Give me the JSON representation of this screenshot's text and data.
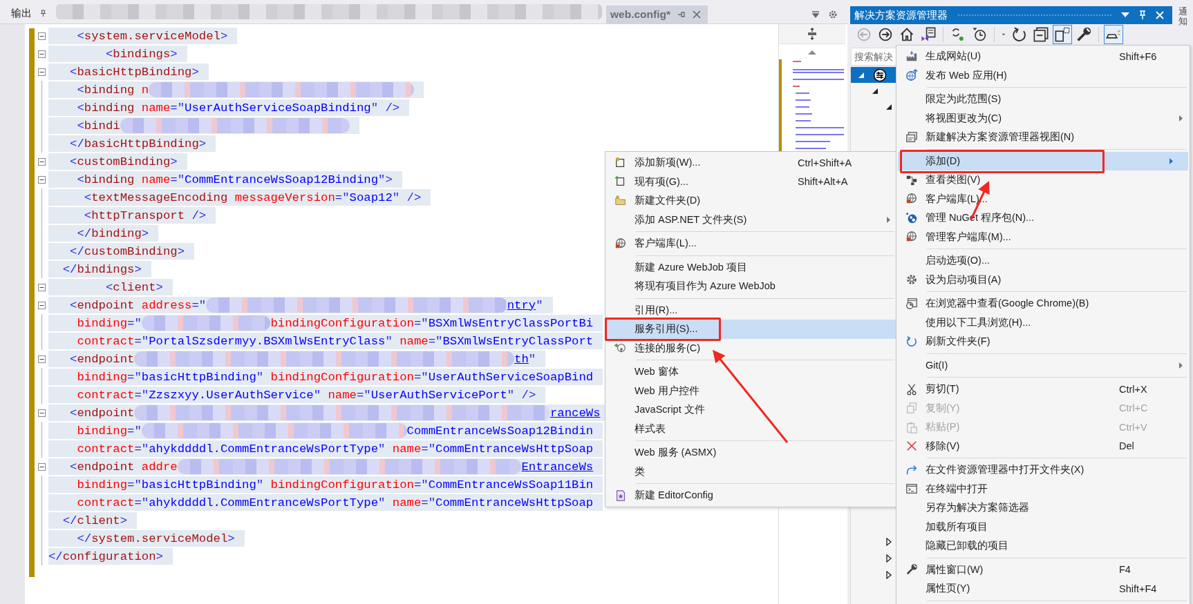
{
  "doc_tabs": [
    {
      "title": "输出",
      "selected": false,
      "kind": "tool"
    },
    {
      "kind": "redacted"
    },
    {
      "title": "web.config*",
      "selected": true,
      "kind": "document"
    }
  ],
  "editor": {
    "lines": [
      {
        "fold": true,
        "tokens": [
          {
            "kind": "punct",
            "text": "    <"
          },
          {
            "kind": "tag",
            "text": "system.serviceModel"
          },
          {
            "kind": "punct",
            "text": ">"
          }
        ]
      },
      {
        "fold": true,
        "tokens": [
          {
            "kind": "punct",
            "text": "        <"
          },
          {
            "kind": "tag",
            "text": "bindings"
          },
          {
            "kind": "punct",
            "text": ">"
          }
        ]
      },
      {
        "fold": true,
        "tokens": [
          {
            "kind": "punct",
            "text": "   <"
          },
          {
            "kind": "tag",
            "text": "basicHttpBinding"
          },
          {
            "kind": "punct",
            "text": ">"
          }
        ]
      },
      {
        "fold": false,
        "tokens": [
          {
            "kind": "punct",
            "text": "    <"
          },
          {
            "kind": "tag",
            "text": "binding"
          },
          {
            "kind": "attr",
            "text": " n"
          },
          {
            "kind": "redacted"
          }
        ]
      },
      {
        "fold": false,
        "tokens": [
          {
            "kind": "punct",
            "text": "    <"
          },
          {
            "kind": "tag",
            "text": "binding"
          },
          {
            "kind": "attr",
            "text": " name"
          },
          {
            "kind": "punct",
            "text": "=\""
          },
          {
            "kind": "value",
            "text": "UserAuthServiceSoapBinding"
          },
          {
            "kind": "punct",
            "text": "\" />"
          }
        ]
      },
      {
        "fold": false,
        "tokens": [
          {
            "kind": "punct",
            "text": "    <"
          },
          {
            "kind": "tag",
            "text": "bindi"
          },
          {
            "kind": "redacted"
          }
        ]
      },
      {
        "fold": false,
        "tokens": [
          {
            "kind": "punct",
            "text": "   </"
          },
          {
            "kind": "tag",
            "text": "basicHttpBinding"
          },
          {
            "kind": "punct",
            "text": ">"
          }
        ]
      },
      {
        "fold": true,
        "tokens": [
          {
            "kind": "punct",
            "text": "   <"
          },
          {
            "kind": "tag",
            "text": "customBinding"
          },
          {
            "kind": "punct",
            "text": ">"
          }
        ]
      },
      {
        "fold": true,
        "tokens": [
          {
            "kind": "punct",
            "text": "    <"
          },
          {
            "kind": "tag",
            "text": "binding"
          },
          {
            "kind": "attr",
            "text": " name"
          },
          {
            "kind": "punct",
            "text": "=\""
          },
          {
            "kind": "value",
            "text": "CommEntranceWsSoap12Binding"
          },
          {
            "kind": "punct",
            "text": "\">"
          }
        ]
      },
      {
        "fold": false,
        "tokens": [
          {
            "kind": "punct",
            "text": "     <"
          },
          {
            "kind": "tag",
            "text": "textMessageEncoding"
          },
          {
            "kind": "attr",
            "text": " messageVersion"
          },
          {
            "kind": "punct",
            "text": "=\""
          },
          {
            "kind": "value",
            "text": "Soap12"
          },
          {
            "kind": "punct",
            "text": "\" />"
          }
        ]
      },
      {
        "fold": false,
        "tokens": [
          {
            "kind": "punct",
            "text": "     <"
          },
          {
            "kind": "tag",
            "text": "httpTransport"
          },
          {
            "kind": "punct",
            "text": " />"
          }
        ]
      },
      {
        "fold": false,
        "tokens": [
          {
            "kind": "punct",
            "text": "    </"
          },
          {
            "kind": "tag",
            "text": "binding"
          },
          {
            "kind": "punct",
            "text": ">"
          }
        ]
      },
      {
        "fold": false,
        "tokens": [
          {
            "kind": "punct",
            "text": "   </"
          },
          {
            "kind": "tag",
            "text": "customBinding"
          },
          {
            "kind": "punct",
            "text": ">"
          }
        ]
      },
      {
        "fold": false,
        "tokens": [
          {
            "kind": "punct",
            "text": "  </"
          },
          {
            "kind": "tag",
            "text": "bindings"
          },
          {
            "kind": "punct",
            "text": ">"
          }
        ]
      },
      {
        "fold": true,
        "tokens": [
          {
            "kind": "punct",
            "text": "        <"
          },
          {
            "kind": "tag",
            "text": "client"
          },
          {
            "kind": "punct",
            "text": ">"
          }
        ]
      },
      {
        "fold": true,
        "tokens": [
          {
            "kind": "punct",
            "text": "   <"
          },
          {
            "kind": "tag",
            "text": "endpoint"
          },
          {
            "kind": "attr",
            "text": " address"
          },
          {
            "kind": "punct",
            "text": "=\""
          },
          {
            "kind": "redacted"
          },
          {
            "kind": "link",
            "text": "ntry"
          },
          {
            "kind": "punct",
            "text": "\""
          }
        ]
      },
      {
        "fold": false,
        "tokens": [
          {
            "kind": "attr",
            "text": "    binding"
          },
          {
            "kind": "punct",
            "text": "=\""
          },
          {
            "kind": "redacted"
          },
          {
            "kind": "attr",
            "text": "bindingConfiguration"
          },
          {
            "kind": "punct",
            "text": "=\""
          },
          {
            "kind": "value",
            "text": "BSXmlWsEntryClassPortBi"
          }
        ]
      },
      {
        "fold": false,
        "tokens": [
          {
            "kind": "attr",
            "text": "    contract"
          },
          {
            "kind": "punct",
            "text": "=\""
          },
          {
            "kind": "value",
            "text": "PortalSzsdermyy.BSXmlWsEntryClass"
          },
          {
            "kind": "punct",
            "text": "\""
          },
          {
            "kind": "attr",
            "text": " name"
          },
          {
            "kind": "punct",
            "text": "=\""
          },
          {
            "kind": "value",
            "text": "BSXmlWsEntryClassPort"
          }
        ]
      },
      {
        "fold": true,
        "tokens": [
          {
            "kind": "punct",
            "text": "   <"
          },
          {
            "kind": "tag",
            "text": "endpoint"
          },
          {
            "kind": "redacted"
          },
          {
            "kind": "link",
            "text": "th"
          },
          {
            "kind": "punct",
            "text": "\""
          }
        ]
      },
      {
        "fold": false,
        "tokens": [
          {
            "kind": "attr",
            "text": "    binding"
          },
          {
            "kind": "punct",
            "text": "=\""
          },
          {
            "kind": "value",
            "text": "basicHttpBinding"
          },
          {
            "kind": "punct",
            "text": "\""
          },
          {
            "kind": "attr",
            "text": " bindingConfiguration"
          },
          {
            "kind": "punct",
            "text": "=\""
          },
          {
            "kind": "value",
            "text": "UserAuthServiceSoapBind"
          }
        ]
      },
      {
        "fold": false,
        "tokens": [
          {
            "kind": "attr",
            "text": "    contract"
          },
          {
            "kind": "punct",
            "text": "=\""
          },
          {
            "kind": "value",
            "text": "Zzszxyy.UserAuthService"
          },
          {
            "kind": "punct",
            "text": "\""
          },
          {
            "kind": "attr",
            "text": " name"
          },
          {
            "kind": "punct",
            "text": "=\""
          },
          {
            "kind": "value",
            "text": "UserAuthServicePort"
          },
          {
            "kind": "punct",
            "text": "\" />"
          }
        ]
      },
      {
        "fold": true,
        "tokens": [
          {
            "kind": "punct",
            "text": "   <"
          },
          {
            "kind": "tag",
            "text": "endpoint"
          },
          {
            "kind": "redacted"
          },
          {
            "kind": "link",
            "text": "ranceWs"
          }
        ]
      },
      {
        "fold": false,
        "tokens": [
          {
            "kind": "attr",
            "text": "    binding"
          },
          {
            "kind": "punct",
            "text": "=\""
          },
          {
            "kind": "redacted"
          },
          {
            "kind": "value",
            "text": "CommEntranceWsSoap12Bindin"
          }
        ]
      },
      {
        "fold": false,
        "tokens": [
          {
            "kind": "attr",
            "text": "    contract"
          },
          {
            "kind": "punct",
            "text": "=\""
          },
          {
            "kind": "value",
            "text": "ahykddddl.CommEntranceWsPortType"
          },
          {
            "kind": "punct",
            "text": "\""
          },
          {
            "kind": "attr",
            "text": " name"
          },
          {
            "kind": "punct",
            "text": "=\""
          },
          {
            "kind": "value",
            "text": "CommEntranceWsHttpSoap"
          }
        ]
      },
      {
        "fold": true,
        "tokens": [
          {
            "kind": "punct",
            "text": "   <"
          },
          {
            "kind": "tag",
            "text": "endpoint"
          },
          {
            "kind": "attr",
            "text": " addre"
          },
          {
            "kind": "redacted"
          },
          {
            "kind": "link",
            "text": "EntranceWs"
          }
        ]
      },
      {
        "fold": false,
        "tokens": [
          {
            "kind": "attr",
            "text": "    binding"
          },
          {
            "kind": "punct",
            "text": "=\""
          },
          {
            "kind": "value",
            "text": "basicHttpBinding"
          },
          {
            "kind": "punct",
            "text": "\""
          },
          {
            "kind": "attr",
            "text": " bindingConfiguration"
          },
          {
            "kind": "punct",
            "text": "=\""
          },
          {
            "kind": "value",
            "text": "CommEntranceWsSoap11Bin"
          }
        ]
      },
      {
        "fold": false,
        "tokens": [
          {
            "kind": "attr",
            "text": "    contract"
          },
          {
            "kind": "punct",
            "text": "=\""
          },
          {
            "kind": "value",
            "text": "ahykddddl.CommEntranceWsPortType"
          },
          {
            "kind": "punct",
            "text": "\""
          },
          {
            "kind": "attr",
            "text": " name"
          },
          {
            "kind": "punct",
            "text": "=\""
          },
          {
            "kind": "value",
            "text": "CommEntranceWsHttpSoap"
          }
        ]
      },
      {
        "fold": false,
        "tokens": [
          {
            "kind": "punct",
            "text": "  </"
          },
          {
            "kind": "tag",
            "text": "client"
          },
          {
            "kind": "punct",
            "text": ">"
          }
        ]
      },
      {
        "fold": false,
        "tokens": [
          {
            "kind": "punct",
            "text": "    </"
          },
          {
            "kind": "tag",
            "text": "system.serviceModel"
          },
          {
            "kind": "punct",
            "text": ">"
          }
        ]
      },
      {
        "fold": false,
        "tokens": [
          {
            "kind": "punct",
            "text": "</"
          },
          {
            "kind": "tag",
            "text": "configuration"
          },
          {
            "kind": "punct",
            "text": ">"
          }
        ]
      }
    ]
  },
  "solution_explorer": {
    "title": "解决方案资源管理器",
    "toolbar_buttons": [
      {
        "disabled": true,
        "pressed": false
      },
      {
        "disabled": false,
        "pressed": false
      },
      {
        "disabled": false,
        "pressed": false
      },
      {
        "disabled": false,
        "pressed": false
      },
      {
        "disabled": false,
        "pressed": false
      },
      {
        "disabled": false,
        "pressed": false
      },
      {
        "disabled": false,
        "pressed": false
      },
      {
        "disabled": false,
        "pressed": false
      },
      {
        "disabled": false,
        "pressed": true
      },
      {
        "disabled": false,
        "pressed": false
      },
      {
        "disabled": false,
        "pressed": true
      }
    ],
    "search": {
      "placeholder": "搜索解决"
    },
    "tree": [
      {
        "selected": true,
        "expanded": true,
        "children": [
          {
            "selected": false,
            "expanded": true,
            "children": [
              {
                "selected": false,
                "expanded": true
              }
            ]
          }
        ]
      }
    ],
    "lower_nodes": [
      {
        "expanded": false
      },
      {
        "expanded": false
      },
      {
        "expanded": false
      }
    ]
  },
  "side_tabs": [
    "通知"
  ],
  "add_submenu": [
    {
      "kind": "item",
      "label": "添加新项(W)...",
      "shortcut": "Ctrl+Shift+A",
      "submenu": false,
      "selected": false,
      "annotated": false
    },
    {
      "kind": "item",
      "label": "现有项(G)...",
      "shortcut": "Shift+Alt+A",
      "submenu": false,
      "selected": false,
      "annotated": false
    },
    {
      "kind": "item",
      "label": "新建文件夹(D)",
      "submenu": false,
      "selected": false,
      "annotated": false
    },
    {
      "kind": "item",
      "label": "添加 ASP.NET 文件夹(S)",
      "submenu": true,
      "selected": false,
      "annotated": false
    },
    {
      "kind": "separator"
    },
    {
      "kind": "item",
      "label": "客户端库(L)...",
      "submenu": false,
      "selected": false,
      "annotated": false
    },
    {
      "kind": "separator"
    },
    {
      "kind": "item",
      "label": "新建 Azure WebJob 项目",
      "submenu": false,
      "selected": false,
      "annotated": false
    },
    {
      "kind": "item",
      "label": "将现有项目作为 Azure WebJob",
      "submenu": false,
      "selected": false,
      "annotated": false
    },
    {
      "kind": "separator"
    },
    {
      "kind": "item",
      "label": "引用(R)...",
      "submenu": false,
      "selected": false,
      "annotated": false
    },
    {
      "kind": "item",
      "label": "服务引用(S)...",
      "submenu": false,
      "selected": true,
      "annotated": true
    },
    {
      "kind": "item",
      "label": "连接的服务(C)",
      "submenu": false,
      "selected": false,
      "annotated": false
    },
    {
      "kind": "separator"
    },
    {
      "kind": "item",
      "label": "Web 窗体",
      "submenu": false,
      "selected": false,
      "annotated": false
    },
    {
      "kind": "item",
      "label": "Web 用户控件",
      "submenu": false,
      "selected": false,
      "annotated": false
    },
    {
      "kind": "item",
      "label": "JavaScript 文件",
      "submenu": false,
      "selected": false,
      "annotated": false
    },
    {
      "kind": "item",
      "label": "样式表",
      "submenu": false,
      "selected": false,
      "annotated": false
    },
    {
      "kind": "separator"
    },
    {
      "kind": "item",
      "label": "Web 服务 (ASMX)",
      "submenu": false,
      "selected": false,
      "annotated": false
    },
    {
      "kind": "item",
      "label": "类",
      "submenu": false,
      "selected": false,
      "annotated": false
    },
    {
      "kind": "separator"
    },
    {
      "kind": "item",
      "label": "新建 EditorConfig",
      "submenu": false,
      "selected": false,
      "annotated": false
    }
  ],
  "context_menu": [
    {
      "kind": "item",
      "label": "生成网站(U)",
      "shortcut": "Shift+F6",
      "submenu": false,
      "selected": false,
      "disabled": false,
      "annotated": false
    },
    {
      "kind": "item",
      "label": "发布 Web 应用(H)",
      "submenu": false,
      "selected": false,
      "disabled": false,
      "annotated": false
    },
    {
      "kind": "separator"
    },
    {
      "kind": "item",
      "label": "限定为此范围(S)",
      "submenu": false,
      "selected": false,
      "disabled": false,
      "annotated": false
    },
    {
      "kind": "item",
      "label": "将视图更改为(C)",
      "submenu": true,
      "selected": false,
      "disabled": false,
      "annotated": false
    },
    {
      "kind": "item",
      "label": "新建解决方案资源管理器视图(N)",
      "submenu": false,
      "selected": false,
      "disabled": false,
      "annotated": false
    },
    {
      "kind": "separator"
    },
    {
      "kind": "item",
      "label": "添加(D)",
      "submenu": true,
      "selected": true,
      "disabled": false,
      "annotated": true
    },
    {
      "kind": "item",
      "label": "查看类图(V)",
      "submenu": false,
      "selected": false,
      "disabled": false,
      "annotated": false
    },
    {
      "kind": "item",
      "label": "客户端库(L)...",
      "submenu": false,
      "selected": false,
      "disabled": false,
      "annotated": false
    },
    {
      "kind": "item",
      "label": "管理 NuGet 程序包(N)...",
      "submenu": false,
      "selected": false,
      "disabled": false,
      "annotated": false
    },
    {
      "kind": "item",
      "label": "管理客户端库(M)...",
      "submenu": false,
      "selected": false,
      "disabled": false,
      "annotated": false
    },
    {
      "kind": "separator"
    },
    {
      "kind": "item",
      "label": "启动选项(O)...",
      "submenu": false,
      "selected": false,
      "disabled": false,
      "annotated": false
    },
    {
      "kind": "item",
      "label": "设为启动项目(A)",
      "submenu": false,
      "selected": false,
      "disabled": false,
      "annotated": false
    },
    {
      "kind": "separator"
    },
    {
      "kind": "item",
      "label": "在浏览器中查看(Google Chrome)(B)",
      "submenu": false,
      "selected": false,
      "disabled": false,
      "annotated": false
    },
    {
      "kind": "item",
      "label": "使用以下工具浏览(H)...",
      "submenu": false,
      "selected": false,
      "disabled": false,
      "annotated": false
    },
    {
      "kind": "item",
      "label": "刷新文件夹(F)",
      "submenu": false,
      "selected": false,
      "disabled": false,
      "annotated": false
    },
    {
      "kind": "separator"
    },
    {
      "kind": "item",
      "label": "Git(I)",
      "submenu": true,
      "selected": false,
      "disabled": false,
      "annotated": false
    },
    {
      "kind": "separator"
    },
    {
      "kind": "item",
      "label": "剪切(T)",
      "shortcut": "Ctrl+X",
      "submenu": false,
      "selected": false,
      "disabled": false,
      "annotated": false
    },
    {
      "kind": "item",
      "label": "复制(Y)",
      "shortcut": "Ctrl+C",
      "submenu": false,
      "selected": false,
      "disabled": true,
      "annotated": false
    },
    {
      "kind": "item",
      "label": "粘贴(P)",
      "shortcut": "Ctrl+V",
      "submenu": false,
      "selected": false,
      "disabled": true,
      "annotated": false
    },
    {
      "kind": "item",
      "label": "移除(V)",
      "shortcut": "Del",
      "submenu": false,
      "selected": false,
      "disabled": false,
      "annotated": false
    },
    {
      "kind": "separator"
    },
    {
      "kind": "item",
      "label": "在文件资源管理器中打开文件夹(X)",
      "submenu": false,
      "selected": false,
      "disabled": false,
      "annotated": false
    },
    {
      "kind": "item",
      "label": "在终端中打开",
      "submenu": false,
      "selected": false,
      "disabled": false,
      "annotated": false
    },
    {
      "kind": "item",
      "label": "另存为解决方案筛选器",
      "submenu": false,
      "selected": false,
      "disabled": false,
      "annotated": false
    },
    {
      "kind": "item",
      "label": "加载所有项目",
      "submenu": false,
      "selected": false,
      "disabled": false,
      "annotated": false
    },
    {
      "kind": "item",
      "label": "隐藏已卸载的项目",
      "submenu": false,
      "selected": false,
      "disabled": false,
      "annotated": false
    },
    {
      "kind": "separator"
    },
    {
      "kind": "item",
      "label": "属性窗口(W)",
      "shortcut": "F4",
      "submenu": false,
      "selected": false,
      "disabled": false,
      "annotated": false
    },
    {
      "kind": "item",
      "label": "属性页(Y)",
      "shortcut": "Shift+F4",
      "submenu": false,
      "selected": false,
      "disabled": false,
      "annotated": false
    },
    {
      "kind": "separator"
    }
  ]
}
